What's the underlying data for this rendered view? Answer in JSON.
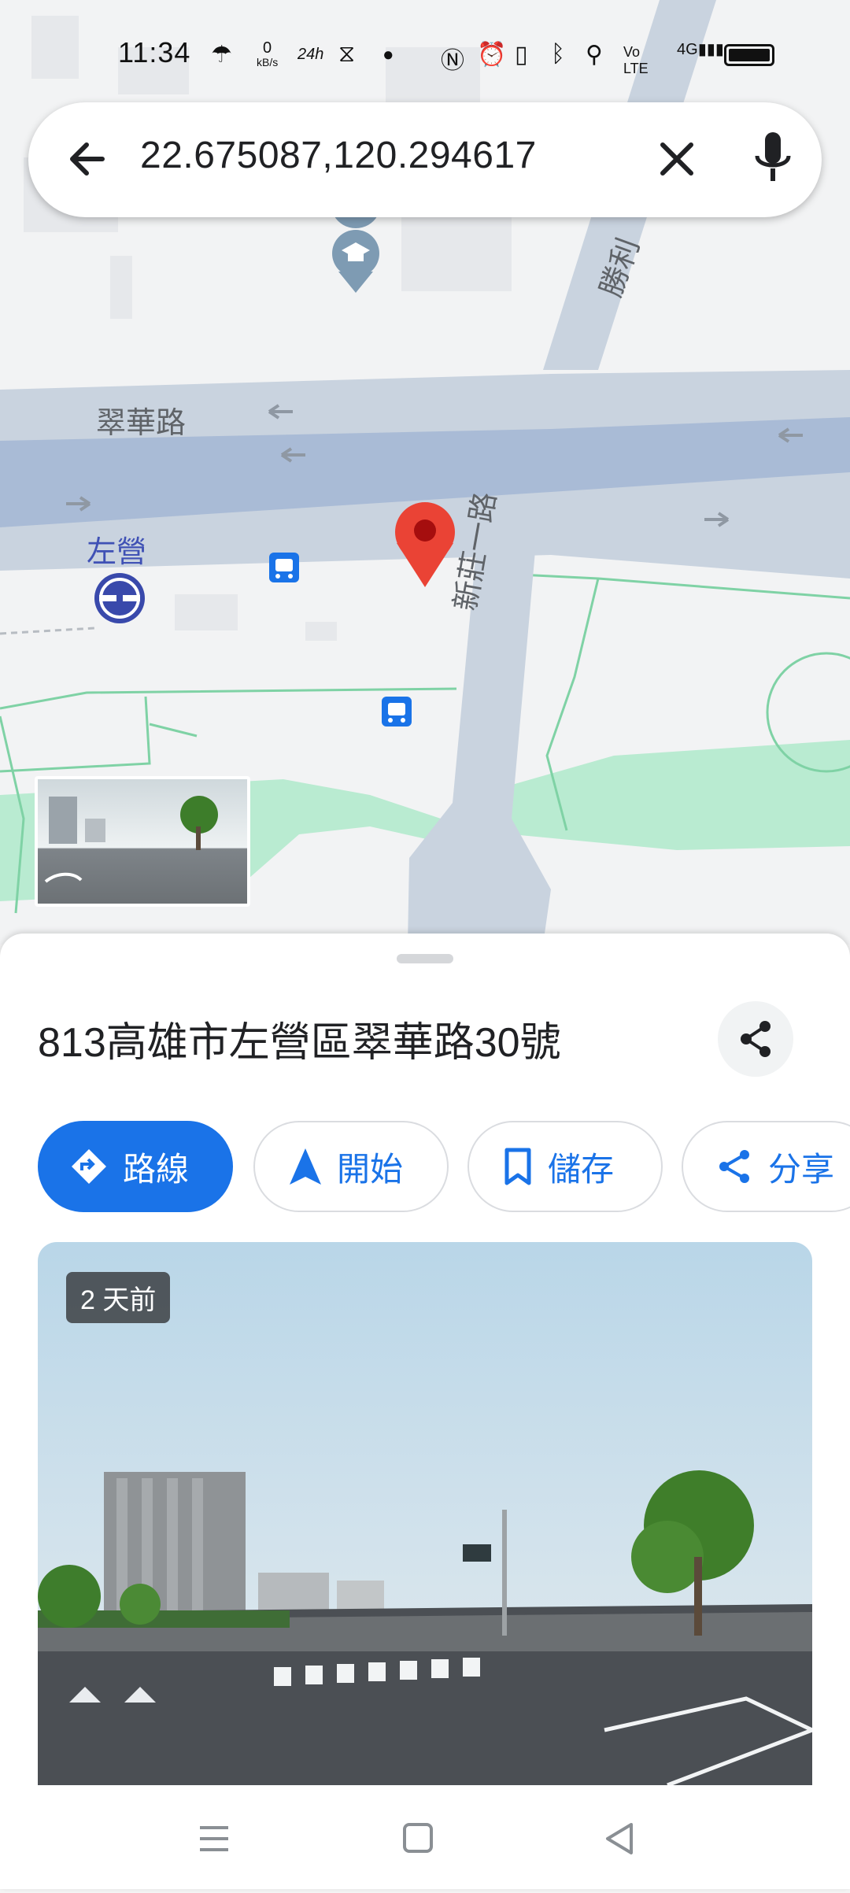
{
  "status_bar": {
    "time": "11:34",
    "net_speed": "0",
    "net_unit": "kB/s",
    "signal_label": "4G"
  },
  "search": {
    "query": "22.675087,120.294617"
  },
  "map": {
    "labels": {
      "road_cuihua": "翠華路",
      "road_xinzhuang": "新莊一路",
      "road_shengli": "勝利",
      "station": "左營"
    }
  },
  "place": {
    "address": "813高雄市左營區翠華路30號",
    "actions": [
      {
        "label": "路線",
        "icon": "directions-icon"
      },
      {
        "label": "開始",
        "icon": "navigation-icon"
      },
      {
        "label": "儲存",
        "icon": "bookmark-icon"
      },
      {
        "label": "分享",
        "icon": "share-icon"
      }
    ],
    "photo_age": "2 天前"
  },
  "colors": {
    "accent": "#1a73e8",
    "pin": "#ea4335",
    "park": "#b9ebd1",
    "road": "#c9d3df",
    "main_road": "#a9bbd6"
  }
}
